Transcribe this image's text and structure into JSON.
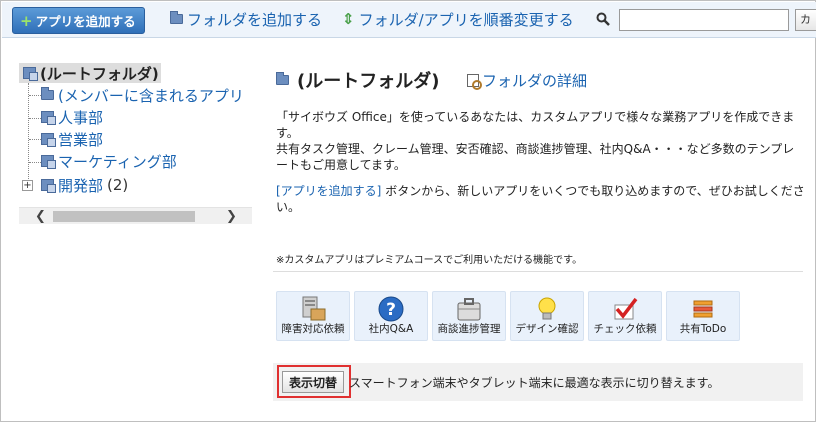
{
  "toolbar": {
    "add_app_label": "アプリを追加する",
    "add_folder_label": "フォルダを追加する",
    "reorder_label": "フォルダ/アプリを順番変更する",
    "search_placeholder": "",
    "search_button_label": "カ"
  },
  "tree": {
    "root_label": "(ルートフォルダ)",
    "items": [
      {
        "label": "(メンバーに含まれるアプリ",
        "count": ""
      },
      {
        "label": "人事部",
        "count": ""
      },
      {
        "label": "営業部",
        "count": ""
      },
      {
        "label": "マーケティング部",
        "count": ""
      },
      {
        "label": "開発部",
        "count": "(2)"
      }
    ]
  },
  "main": {
    "title": "(ルートフォルダ)",
    "detail_link": "フォルダの詳細",
    "desc_line1": "「サイボウズ Office」を使っているあなたは、カスタムアプリで様々な業務アプリを作成できます。",
    "desc_line2": "共有タスク管理、クレーム管理、安否確認、商談進捗管理、社内Q&A・・・など多数のテンプレートもご用意してます。",
    "desc2_link": "[アプリを追加する]",
    "desc2_rest": "ボタンから、新しいアプリをいくつでも取り込めますので、ぜひお試しください。",
    "note": "※カスタムアプリはプレミアムコースでご利用いただける機能です。",
    "tiles": [
      {
        "label": "障害対応依頼",
        "icon": "server-icon"
      },
      {
        "label": "社内Q&A",
        "icon": "question-icon"
      },
      {
        "label": "商談進捗管理",
        "icon": "briefcase-icon"
      },
      {
        "label": "デザイン確認",
        "icon": "lightbulb-icon"
      },
      {
        "label": "チェック依頼",
        "icon": "checkmark-icon"
      },
      {
        "label": "共有ToDo",
        "icon": "stack-icon"
      }
    ],
    "switch_button": "表示切替",
    "switch_text": "スマートフォン端末やタブレット端末に最適な表示に切り替えます。"
  },
  "colors": {
    "link": "#1a63b0",
    "accent_button": "#2f6fb8",
    "highlight": "#e03030"
  }
}
